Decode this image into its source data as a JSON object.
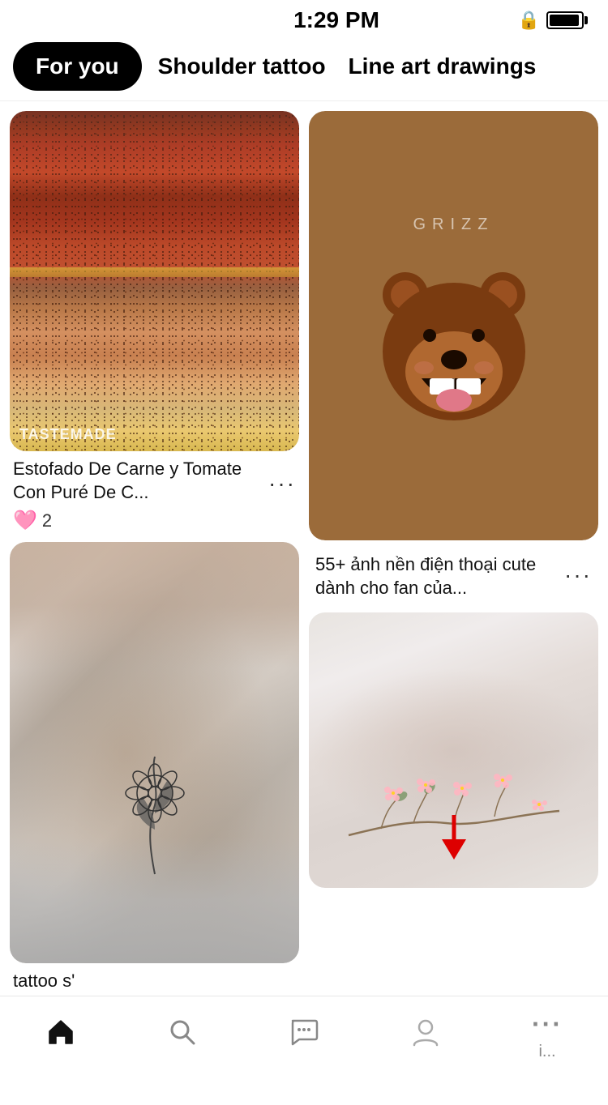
{
  "statusBar": {
    "time": "1:29 PM"
  },
  "tabs": [
    {
      "id": "for-you",
      "label": "For you",
      "active": true
    },
    {
      "id": "shoulder-tattoo",
      "label": "Shoulder tattoo",
      "active": false
    },
    {
      "id": "line-art",
      "label": "Line art drawings",
      "active": false
    }
  ],
  "cards": [
    {
      "id": "card-food",
      "type": "food",
      "title": "Estofado De Carne y Tomate Con Puré De C...",
      "likes": "2",
      "sourceBadge": "TASTEMADE",
      "moreLabel": "···"
    },
    {
      "id": "card-bear",
      "type": "bear",
      "subtitle": "GRIZZ",
      "title": "55+ ảnh nền điện thoại cute dành cho fan của...",
      "moreLabel": "···"
    },
    {
      "id": "card-tattoo-left",
      "type": "tattoo-left",
      "title": "tattoo s'",
      "moreLabel": "···"
    },
    {
      "id": "card-tattoo-right",
      "type": "tattoo-right",
      "title": "",
      "moreLabel": "···"
    }
  ],
  "bottomNav": {
    "items": [
      {
        "id": "home",
        "icon": "⌂",
        "label": "",
        "active": true
      },
      {
        "id": "search",
        "icon": "⌕",
        "label": "",
        "active": false
      },
      {
        "id": "messages",
        "icon": "💬",
        "label": "",
        "active": false
      },
      {
        "id": "profile",
        "icon": "person",
        "label": "",
        "active": false
      },
      {
        "id": "more",
        "label": "i...",
        "active": false
      }
    ]
  }
}
